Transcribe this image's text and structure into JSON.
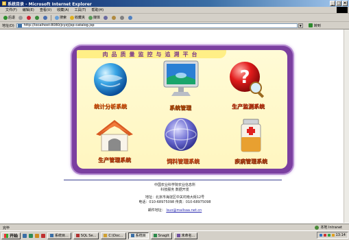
{
  "window": {
    "title": "系统目录 - Microsoft Internet Explorer",
    "buttons": [
      "_",
      "□",
      "×"
    ]
  },
  "menu": [
    "文件(F)",
    "编辑(E)",
    "查看(V)",
    "收藏(A)",
    "工具(T)",
    "帮助(H)"
  ],
  "toolbar": {
    "back": "后退",
    "search": "搜索",
    "favorites": "收藏夹",
    "media": "媒体"
  },
  "address": {
    "label": "地址(D)",
    "url": "http://localhost:8080/jcyzj/jsp-catalog.jsp",
    "go": "转到"
  },
  "portal": {
    "header": "肉品质量监控与追溯平台",
    "systems": [
      {
        "label": "统计分析系统",
        "color": "#e05a10",
        "icon": "globe-icon"
      },
      {
        "label": "系统管理",
        "color": "#b04a08",
        "icon": "monitor-icon"
      },
      {
        "label": "生产监测系统",
        "color": "#c23010",
        "icon": "question-icon"
      },
      {
        "label": "生产管理系统",
        "color": "#c24010",
        "icon": "house-icon"
      },
      {
        "label": "饲料管理系统",
        "color": "#d05020",
        "icon": "blue-sphere-icon"
      },
      {
        "label": "疾病管理系统",
        "color": "#b03a10",
        "icon": "medicine-icon"
      }
    ]
  },
  "footer": {
    "org": "中国农业科学院农业信息所",
    "dev": "科技服务 数据开发",
    "addr": "地址：北京市海淀区中关村南大街12号",
    "phone": "电话：010-68975098  传真：010-68975098",
    "email_label": "邮件地址：",
    "email": "lsuo@mailsaa.net.cn"
  },
  "status": {
    "left": "完毕",
    "zone": "本地 Intranet"
  },
  "taskbar": {
    "start": "开始",
    "tasks": [
      "系统目...",
      "SQL Se...",
      "C:\\Doc...",
      "系统目",
      "SnagIt",
      "未命名..."
    ],
    "active_index": 3,
    "clock": "13:14"
  }
}
